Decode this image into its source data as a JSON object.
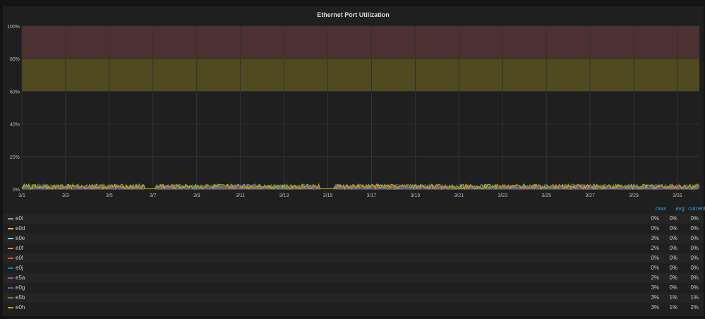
{
  "chart_data": {
    "type": "line",
    "title": "Ethernet Port Utilization",
    "xlabel": "",
    "ylabel": "",
    "x_ticks": [
      "3/1",
      "3/3",
      "3/5",
      "3/7",
      "3/9",
      "3/11",
      "3/13",
      "3/15",
      "3/17",
      "3/19",
      "3/21",
      "3/23",
      "3/25",
      "3/27",
      "3/29",
      "3/31"
    ],
    "y_ticks": [
      "0%",
      "20%",
      "40%",
      "60%",
      "80%",
      "100%"
    ],
    "ylim": [
      0,
      100
    ],
    "xlim_days": [
      0,
      31
    ],
    "thresholds": [
      {
        "from": 60,
        "to": 80,
        "color": "#4f4a1f"
      },
      {
        "from": 80,
        "to": 100,
        "color": "#4b3131"
      }
    ],
    "grid": true,
    "legend_placement": "bottom",
    "legend_columns": [
      "max",
      "avg",
      "current"
    ],
    "series": [
      {
        "name": "e0i",
        "color": "#7eb26d",
        "max": "0%",
        "avg": "0%",
        "current": "0%"
      },
      {
        "name": "e0d",
        "color": "#eab839",
        "max": "0%",
        "avg": "0%",
        "current": "0%"
      },
      {
        "name": "e0e",
        "color": "#6ed0e0",
        "max": "3%",
        "avg": "0%",
        "current": "0%"
      },
      {
        "name": "e0f",
        "color": "#ef843c",
        "max": "2%",
        "avg": "0%",
        "current": "0%"
      },
      {
        "name": "e0l",
        "color": "#e24d42",
        "max": "0%",
        "avg": "0%",
        "current": "0%"
      },
      {
        "name": "e0j",
        "color": "#1f78c1",
        "max": "0%",
        "avg": "0%",
        "current": "0%"
      },
      {
        "name": "e5a",
        "color": "#ba43a9",
        "max": "2%",
        "avg": "0%",
        "current": "0%"
      },
      {
        "name": "e0g",
        "color": "#705da0",
        "max": "3%",
        "avg": "0%",
        "current": "0%"
      },
      {
        "name": "e5b",
        "color": "#508642",
        "max": "3%",
        "avg": "1%",
        "current": "1%"
      },
      {
        "name": "e0h",
        "color": "#cca300",
        "max": "3%",
        "avg": "1%",
        "current": "2%"
      }
    ]
  }
}
